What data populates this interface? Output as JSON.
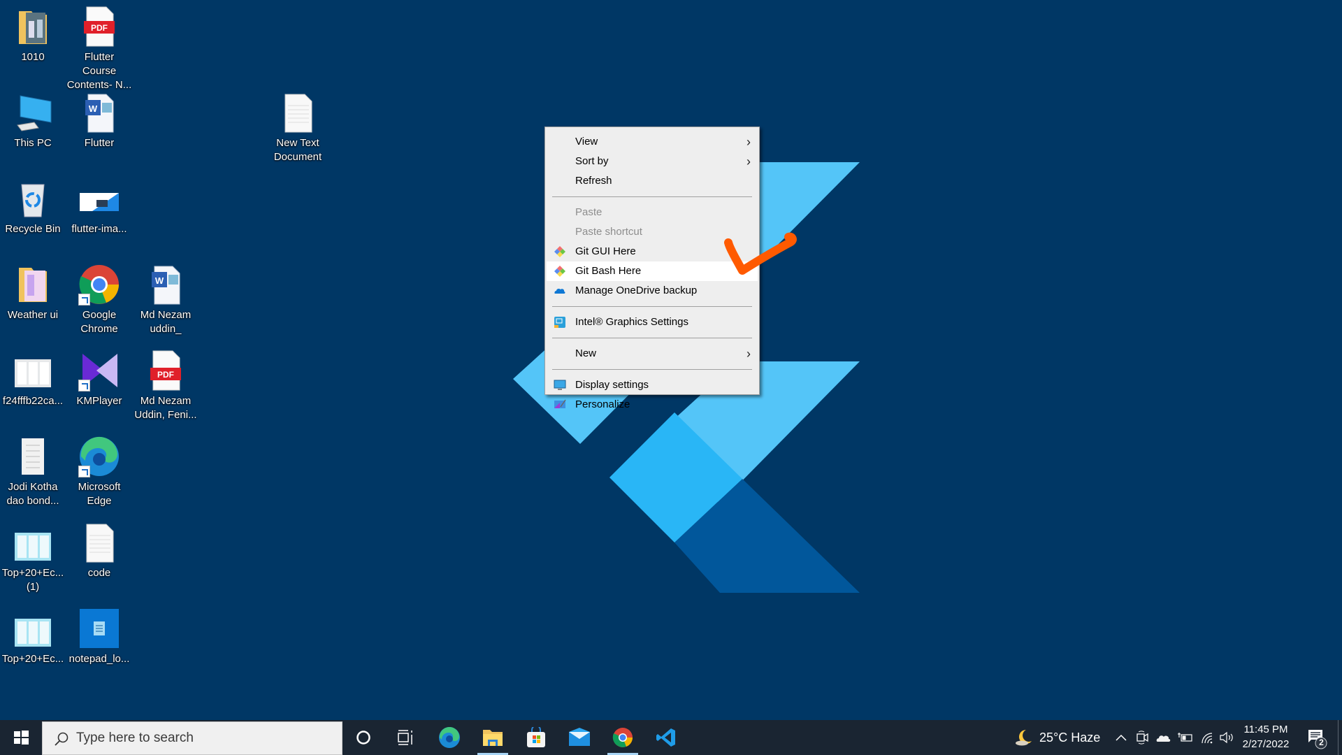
{
  "desktop": {
    "background_color": "#003765",
    "icons": [
      {
        "label": "1010",
        "icon": "folder-photo-icon"
      },
      {
        "label": "Flutter Course Contents- N...",
        "icon": "pdf-file-icon"
      },
      {
        "label": "This PC",
        "icon": "computer-icon"
      },
      {
        "label": "Flutter",
        "icon": "word-document-icon"
      },
      {
        "label": "New Text Document",
        "icon": "text-file-icon"
      },
      {
        "label": "Recycle Bin",
        "icon": "recycle-bin-icon"
      },
      {
        "label": "flutter-ima...",
        "icon": "image-thumbnail-icon"
      },
      {
        "label": "Weather ui",
        "icon": "folder-thumbnail-icon"
      },
      {
        "label": "Google Chrome",
        "icon": "chrome-icon"
      },
      {
        "label": "Md Nezam uddin_",
        "icon": "word-document-icon"
      },
      {
        "label": "f24fffb22ca...",
        "icon": "image-thumbnail-icon"
      },
      {
        "label": "KMPlayer",
        "icon": "kmplayer-icon"
      },
      {
        "label": "Md Nezam Uddin, Feni...",
        "icon": "pdf-file-icon"
      },
      {
        "label": "Jodi Kotha dao bond...",
        "icon": "document-thumbnail-icon"
      },
      {
        "label": "Microsoft Edge",
        "icon": "edge-icon"
      },
      {
        "label": "Top+20+Ec... (1)",
        "icon": "image-thumbnail-icon"
      },
      {
        "label": "code",
        "icon": "text-file-icon"
      },
      {
        "label": "Top+20+Ec...",
        "icon": "image-thumbnail-icon"
      },
      {
        "label": "notepad_lo...",
        "icon": "notepad-icon"
      }
    ]
  },
  "context_menu": {
    "items": [
      {
        "label": "View",
        "submenu": true,
        "enabled": true
      },
      {
        "label": "Sort by",
        "submenu": true,
        "enabled": true
      },
      {
        "label": "Refresh",
        "enabled": true
      },
      {
        "label": "Paste",
        "enabled": false
      },
      {
        "label": "Paste shortcut",
        "enabled": false
      },
      {
        "label": "Git GUI Here",
        "icon": "git-icon",
        "enabled": true
      },
      {
        "label": "Git Bash Here",
        "icon": "git-icon",
        "enabled": true,
        "highlighted": true
      },
      {
        "label": "Manage OneDrive backup",
        "icon": "onedrive-icon",
        "enabled": true
      },
      {
        "label": "Intel® Graphics Settings",
        "icon": "intel-graphics-icon",
        "enabled": true
      },
      {
        "label": "New",
        "submenu": true,
        "enabled": true
      },
      {
        "label": "Display settings",
        "icon": "display-icon",
        "enabled": true
      },
      {
        "label": "Personalize",
        "icon": "personalize-icon",
        "enabled": true
      }
    ],
    "chevron": "›",
    "annotation_color": "#ff5a00"
  },
  "taskbar": {
    "search_placeholder": "Type here to search",
    "pinned": [
      {
        "name": "cortana",
        "icon": "cortana-icon"
      },
      {
        "name": "task-view",
        "icon": "task-view-icon"
      },
      {
        "name": "microsoft-edge",
        "icon": "edge-icon"
      },
      {
        "name": "file-explorer",
        "icon": "folder-icon",
        "running": true
      },
      {
        "name": "microsoft-store",
        "icon": "store-icon"
      },
      {
        "name": "mail",
        "icon": "mail-icon"
      },
      {
        "name": "google-chrome",
        "icon": "chrome-icon",
        "running": true
      },
      {
        "name": "vs-code",
        "icon": "vscode-icon"
      }
    ],
    "weather": {
      "temp": "25°C",
      "condition": "Haze"
    },
    "clock": {
      "time": "11:45 PM",
      "date": "2/27/2022"
    },
    "notifications_count": "2"
  }
}
